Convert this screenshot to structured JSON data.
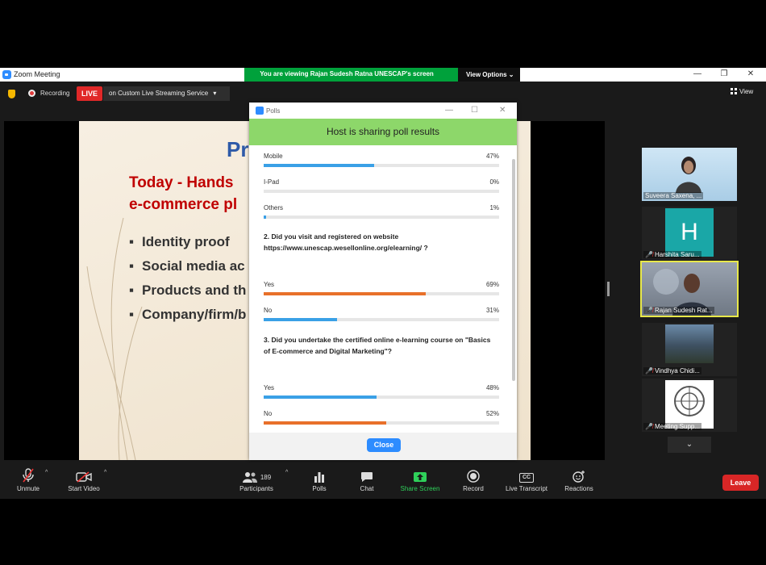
{
  "titlebar": {
    "title": "Zoom Meeting",
    "viewing_text": "You are viewing Rajan Sudesh Ratna UNESCAP's screen",
    "view_options": "View Options"
  },
  "recbar": {
    "recording": "Recording",
    "live": "LIVE",
    "stream": "on Custom Live Streaming Service",
    "view": "View"
  },
  "slide": {
    "title": "Pr",
    "heading_line1": "Today - Hands",
    "heading_line2": "e-commerce pl",
    "bullets": [
      "Identity proof",
      "Social media ac",
      "Products and th",
      "Company/firm/b"
    ]
  },
  "poll": {
    "window_title": "Polls",
    "banner": "Host is sharing poll results",
    "q1_options": [
      {
        "label": "Mobile",
        "percent": "47%",
        "value": 47
      },
      {
        "label": "I-Pad",
        "percent": "0%",
        "value": 0
      },
      {
        "label": "Others",
        "percent": "1%",
        "value": 1
      }
    ],
    "q2": "2. Did you visit and registered on website https://www.unescap.wesellonline.org/elearning/ ?",
    "q2_options": [
      {
        "label": "Yes",
        "percent": "69%",
        "value": 69
      },
      {
        "label": "No",
        "percent": "31%",
        "value": 31
      }
    ],
    "q3": "3. Did you undertake the certified online e-learning course on \"Basics of E-commerce and Digital Marketing\"?",
    "q3_options": [
      {
        "label": "Yes",
        "percent": "48%",
        "value": 48
      },
      {
        "label": "No",
        "percent": "52%",
        "value": 52
      }
    ],
    "close_label": "Close",
    "colors": {
      "blue": "#3aa0e6",
      "orange": "#e8702a"
    }
  },
  "participants": [
    {
      "name": "Suveera Saxena, ...",
      "muted": false
    },
    {
      "name": "Harshita Saru...",
      "muted": true,
      "initial": "H"
    },
    {
      "name": "Rajan Sudesh Rat...",
      "muted": true
    },
    {
      "name": "Vindhya Chidi...",
      "muted": true
    },
    {
      "name": "Meeting Supp...",
      "muted": true
    }
  ],
  "toolbar": {
    "unmute": "Unmute",
    "start_video": "Start Video",
    "participants": "Participants",
    "participant_count": "189",
    "polls": "Polls",
    "chat": "Chat",
    "share_screen": "Share Screen",
    "record": "Record",
    "live_transcript": "Live Transcript",
    "reactions": "Reactions",
    "leave": "Leave",
    "cc_icon_text": "CC"
  }
}
